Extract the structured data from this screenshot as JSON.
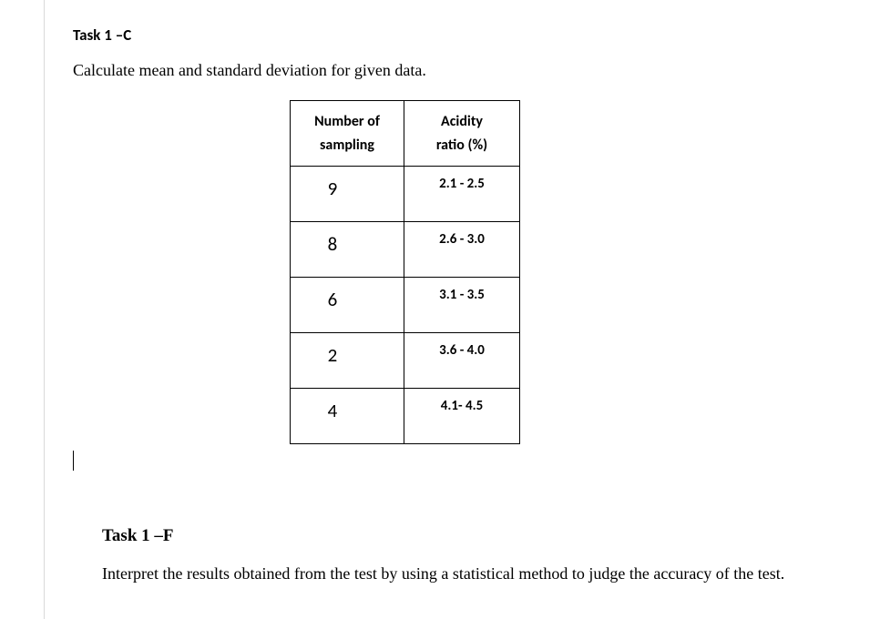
{
  "task1": {
    "heading": "Task 1 –C",
    "instruction": "Calculate mean and standard deviation for given data.",
    "table": {
      "headers": {
        "sampling_line1": "Number of",
        "sampling_line2": "sampling",
        "acidity_line1": "Acidity",
        "acidity_line2": "ratio (%)"
      },
      "rows": [
        {
          "sampling": "9",
          "acidity": "2.1 - 2.5"
        },
        {
          "sampling": "8",
          "acidity": "2.6 - 3.0"
        },
        {
          "sampling": "6",
          "acidity": "3.1 - 3.5"
        },
        {
          "sampling": "2",
          "acidity": "3.6 - 4.0"
        },
        {
          "sampling": "4",
          "acidity": "4.1- 4.5"
        }
      ]
    }
  },
  "task2": {
    "heading": "Task 1 –F",
    "text": "Interpret the results obtained from the test by using a statistical method to judge the accuracy of the test."
  }
}
